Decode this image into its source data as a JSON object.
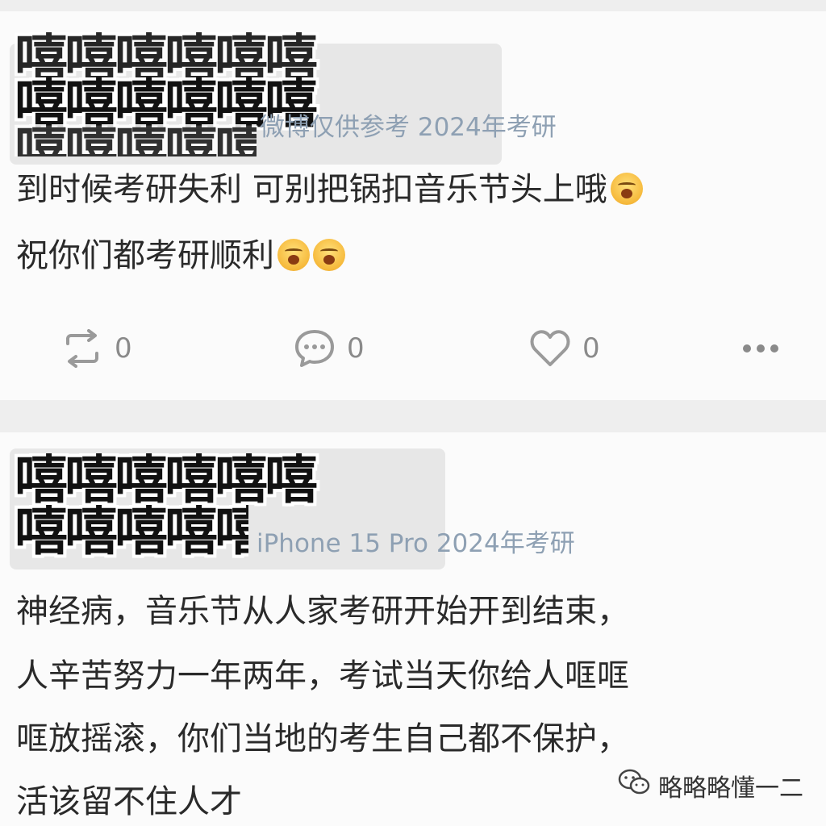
{
  "posts": [
    {
      "censor_line_1": "嘻嘻嘻嘻嘻嘻",
      "censor_line_2": "嘻嘻嘻嘻嘻嘻",
      "meta": "微博仅供参考 2024年考研",
      "lines": [
        "到时候考研失利 可别把锅扣音乐节头上哦",
        "祝你们都考研顺利"
      ],
      "actions": {
        "repost_count": "0",
        "comment_count": "0",
        "like_count": "0"
      }
    },
    {
      "censor_line_1": "嘻嘻嘻嘻嘻嘻",
      "censor_line_2": "嘻嘻嘻嘻嘻嘻",
      "meta": "iPhone 15 Pro 2024年考研",
      "lines": [
        "神经病，音乐节从人家考研开始开到结束，",
        "人辛苦努力一年两年，考试当天你给人哐哐",
        "哐放摇滚，你们当地的考生自己都不保护，",
        "活该留不住人才"
      ]
    }
  ],
  "watermark": {
    "text": "略略略懂一二",
    "icon": "wechat-icon"
  },
  "icons": {
    "repost": "repost-icon",
    "comment": "comment-icon",
    "like": "heart-icon",
    "more": "more-icon",
    "emoji": "emoji-icon"
  }
}
